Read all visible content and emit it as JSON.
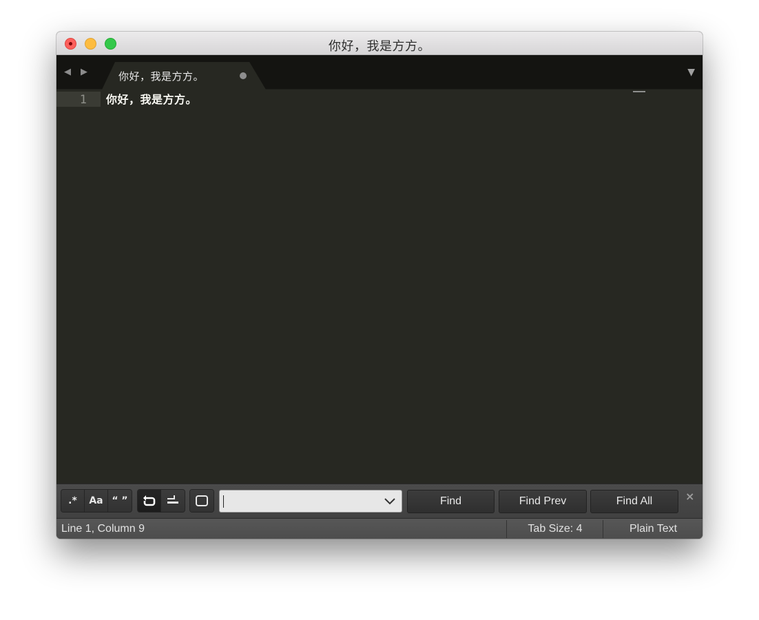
{
  "window": {
    "title": "你好，我是方方。"
  },
  "tabs": [
    {
      "label": "你好，我是方方。",
      "dirty": true
    }
  ],
  "editor": {
    "lines": [
      {
        "number": "1",
        "text": "你好，我是方方。"
      }
    ]
  },
  "find_panel": {
    "options": {
      "regex": ".*",
      "case_sensitive": "Aa",
      "whole_word": "“ ”"
    },
    "input_value": "",
    "buttons": {
      "find": "Find",
      "find_prev": "Find Prev",
      "find_all": "Find All"
    },
    "close": "×"
  },
  "status_bar": {
    "position": "Line 1, Column 9",
    "tab_size": "Tab Size: 4",
    "syntax": "Plain Text"
  },
  "colors": {
    "editor_bg": "#272822",
    "tab_strip_bg": "#141411",
    "text": "#f8f8f2"
  }
}
